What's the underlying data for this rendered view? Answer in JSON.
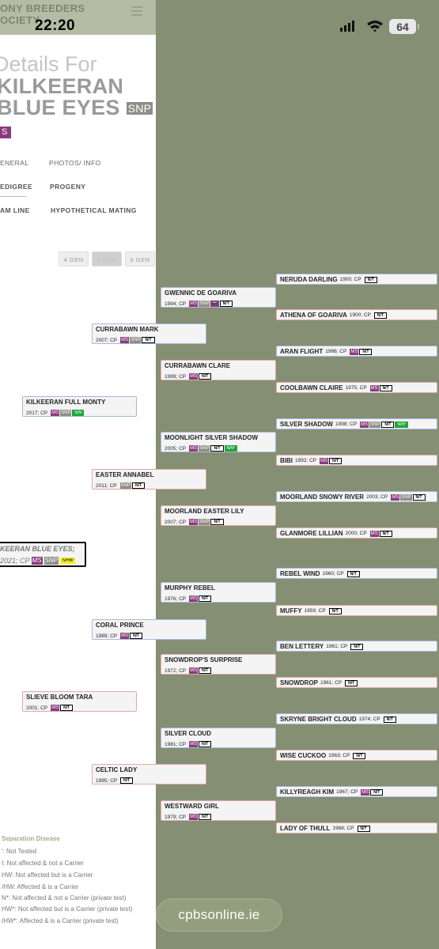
{
  "header": {
    "brand_line1": "ONY BREEDERS",
    "brand_line2": "OCIETY"
  },
  "status": {
    "time": "22:20",
    "battery": "64"
  },
  "page": {
    "title_prefix": "Details For",
    "name_line1": "KILKEERAN",
    "name_line2": "BLUE EYES",
    "snp_badge": "SNP",
    "ms_badge": "S"
  },
  "tabs": {
    "general": "ENERAL",
    "photos": "PHOTOS/ INFO",
    "pedigree": "EDIGREE",
    "progeny": "PROGENY",
    "dam_line": "AM LINE",
    "hypothetical": "HYPOTHETICAL MATING"
  },
  "generations": {
    "gen4": "4 GEN",
    "gen5": "5 GEN",
    "gen6": "6 GEN"
  },
  "subject": {
    "name": "KEERAN BLUE EYES;",
    "info": "2021; CP",
    "ms": "MS",
    "snp": "SNP",
    "status": "N/HW"
  },
  "tags": {
    "ms": "MS",
    "snp": "SNP",
    "nt": "N/T",
    "nn": "N/N",
    "nn_star": "N/N*",
    "camera": "📷"
  },
  "pedigree": [
    {
      "name": "KILKEERAN FULL MONTY",
      "info": "2017; CP"
    },
    {
      "name": "SLIEVE BLOOM TARA",
      "info": "2001; CP"
    },
    {
      "name": "CURRABAWN MARK",
      "info": "2007; CP"
    },
    {
      "name": "EASTER ANNABEL",
      "info": "2011; CP"
    },
    {
      "name": "CORAL PRINCE",
      "info": "1989; CP"
    },
    {
      "name": "CELTIC LADY",
      "info": "1995; CP"
    },
    {
      "name": "GWENNIC DE GOARIVA",
      "info": "1994; CP"
    },
    {
      "name": "CURRABAWN CLARE",
      "info": "1999; CP"
    },
    {
      "name": "MOONLIGHT SILVER SHADOW",
      "info": "2005; CP"
    },
    {
      "name": "MOORLAND EASTER LILY",
      "info": "2007; CP"
    },
    {
      "name": "MURPHY REBEL",
      "info": "1976; CP"
    },
    {
      "name": "SNOWDROP'S SURPRISE",
      "info": "1972; CP"
    },
    {
      "name": "SILVER CLOUD",
      "info": "1981; CP"
    },
    {
      "name": "WESTWARD GIRL",
      "info": "1979; CP"
    },
    {
      "name": "NERUDA DARLING",
      "info": "1900; CP"
    },
    {
      "name": "ATHENA OF GOARIVA",
      "info": "1900; CP"
    },
    {
      "name": "ARAN FLIGHT",
      "info": "1986; CP"
    },
    {
      "name": "COOLBAWN CLAIRE",
      "info": "1975; CP"
    },
    {
      "name": "SILVER SHADOW",
      "info": "1998; CP"
    },
    {
      "name": "BIBI",
      "info": "1992; CP"
    },
    {
      "name": "MOORLAND SNOWY RIVER",
      "info": "2003; CP"
    },
    {
      "name": "GLANMORE LILLIAN",
      "info": "2000; CP"
    },
    {
      "name": "REBEL WIND",
      "info": "1960; CP"
    },
    {
      "name": "MUFFY",
      "info": "1959; CP"
    },
    {
      "name": "BEN LETTERY",
      "info": "1961; CP"
    },
    {
      "name": "SNOWDROP",
      "info": "1961; CP"
    },
    {
      "name": "SKRYNE BRIGHT CLOUD",
      "info": "1974; CP"
    },
    {
      "name": "WISE CUCKOO",
      "info": "1963; CP"
    },
    {
      "name": "KILLYREAGH KIM",
      "info": "1967; CP"
    },
    {
      "name": "LADY OF THULL",
      "info": "1968; CP"
    }
  ],
  "legend": {
    "title": "Separation Disease",
    "lines": [
      "': Not Tested",
      "I: Not affected & not a Carrier",
      "HW: Not affected but is a Carrier",
      "/HW: Affected & is a Carrier",
      "N*: Not affected & not a Carrier (private test)",
      "HW*: Not affected but is a Carrier (private test)",
      "/HW*: Affected & is a Carrier (private test)"
    ]
  },
  "footer": {
    "site": "cpbsonline.ie"
  }
}
